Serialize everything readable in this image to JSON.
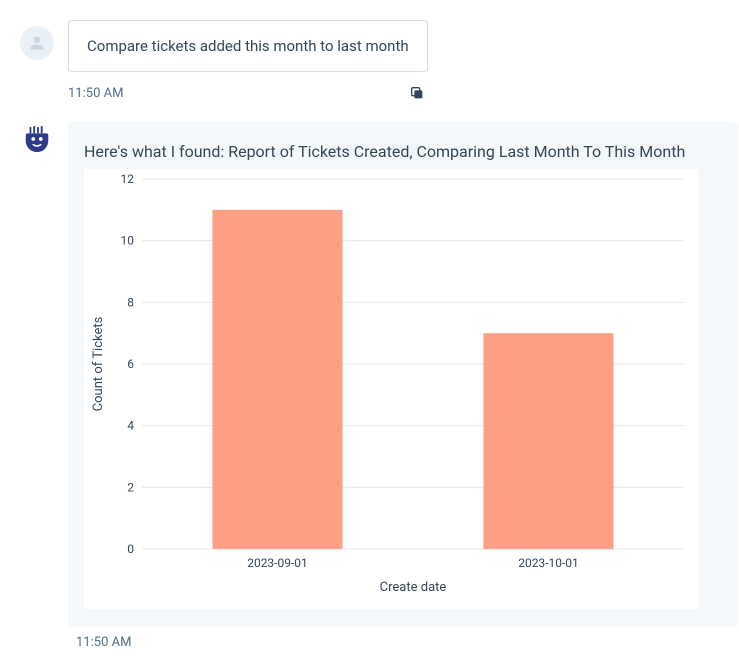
{
  "user_message": {
    "text": "Compare tickets added this month to last month",
    "timestamp": "11:50 AM"
  },
  "bot_message": {
    "headline": "Here's what I found: Report of Tickets Created, Comparing Last Month To This Month",
    "timestamp": "11:50 AM"
  },
  "chart_data": {
    "type": "bar",
    "categories": [
      "2023-09-01",
      "2023-10-01"
    ],
    "values": [
      11,
      7
    ],
    "xlabel": "Create date",
    "ylabel": "Count of Tickets",
    "ylim": [
      0,
      12
    ],
    "yticks": [
      0,
      2,
      4,
      6,
      8,
      10,
      12
    ],
    "bar_color": "#fc9f84"
  }
}
